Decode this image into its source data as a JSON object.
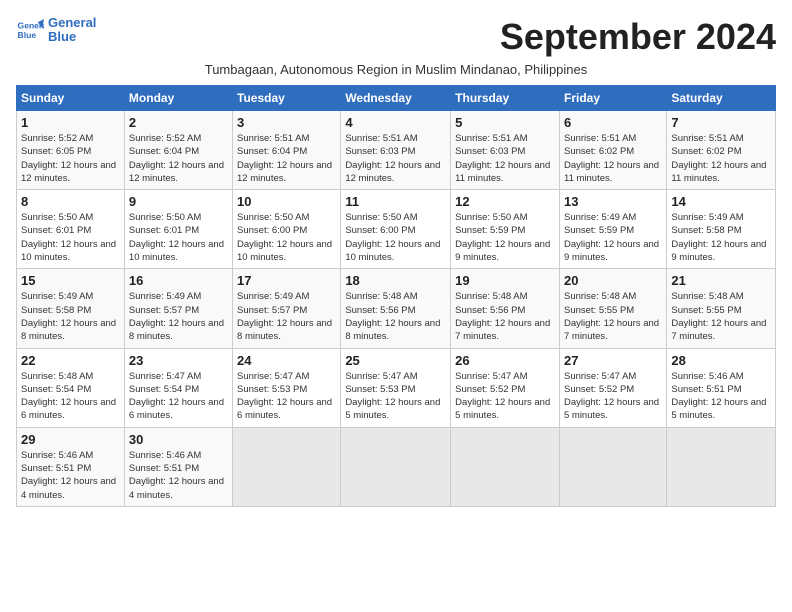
{
  "logo": {
    "line1": "General",
    "line2": "Blue"
  },
  "title": "September 2024",
  "subtitle": "Tumbagaan, Autonomous Region in Muslim Mindanao, Philippines",
  "days_header": [
    "Sunday",
    "Monday",
    "Tuesday",
    "Wednesday",
    "Thursday",
    "Friday",
    "Saturday"
  ],
  "weeks": [
    [
      {
        "day": "1",
        "sunrise": "5:52 AM",
        "sunset": "6:05 PM",
        "daylight": "12 hours and 12 minutes."
      },
      {
        "day": "2",
        "sunrise": "5:52 AM",
        "sunset": "6:04 PM",
        "daylight": "12 hours and 12 minutes."
      },
      {
        "day": "3",
        "sunrise": "5:51 AM",
        "sunset": "6:04 PM",
        "daylight": "12 hours and 12 minutes."
      },
      {
        "day": "4",
        "sunrise": "5:51 AM",
        "sunset": "6:03 PM",
        "daylight": "12 hours and 12 minutes."
      },
      {
        "day": "5",
        "sunrise": "5:51 AM",
        "sunset": "6:03 PM",
        "daylight": "12 hours and 11 minutes."
      },
      {
        "day": "6",
        "sunrise": "5:51 AM",
        "sunset": "6:02 PM",
        "daylight": "12 hours and 11 minutes."
      },
      {
        "day": "7",
        "sunrise": "5:51 AM",
        "sunset": "6:02 PM",
        "daylight": "12 hours and 11 minutes."
      }
    ],
    [
      {
        "day": "8",
        "sunrise": "5:50 AM",
        "sunset": "6:01 PM",
        "daylight": "12 hours and 10 minutes."
      },
      {
        "day": "9",
        "sunrise": "5:50 AM",
        "sunset": "6:01 PM",
        "daylight": "12 hours and 10 minutes."
      },
      {
        "day": "10",
        "sunrise": "5:50 AM",
        "sunset": "6:00 PM",
        "daylight": "12 hours and 10 minutes."
      },
      {
        "day": "11",
        "sunrise": "5:50 AM",
        "sunset": "6:00 PM",
        "daylight": "12 hours and 10 minutes."
      },
      {
        "day": "12",
        "sunrise": "5:50 AM",
        "sunset": "5:59 PM",
        "daylight": "12 hours and 9 minutes."
      },
      {
        "day": "13",
        "sunrise": "5:49 AM",
        "sunset": "5:59 PM",
        "daylight": "12 hours and 9 minutes."
      },
      {
        "day": "14",
        "sunrise": "5:49 AM",
        "sunset": "5:58 PM",
        "daylight": "12 hours and 9 minutes."
      }
    ],
    [
      {
        "day": "15",
        "sunrise": "5:49 AM",
        "sunset": "5:58 PM",
        "daylight": "12 hours and 8 minutes."
      },
      {
        "day": "16",
        "sunrise": "5:49 AM",
        "sunset": "5:57 PM",
        "daylight": "12 hours and 8 minutes."
      },
      {
        "day": "17",
        "sunrise": "5:49 AM",
        "sunset": "5:57 PM",
        "daylight": "12 hours and 8 minutes."
      },
      {
        "day": "18",
        "sunrise": "5:48 AM",
        "sunset": "5:56 PM",
        "daylight": "12 hours and 8 minutes."
      },
      {
        "day": "19",
        "sunrise": "5:48 AM",
        "sunset": "5:56 PM",
        "daylight": "12 hours and 7 minutes."
      },
      {
        "day": "20",
        "sunrise": "5:48 AM",
        "sunset": "5:55 PM",
        "daylight": "12 hours and 7 minutes."
      },
      {
        "day": "21",
        "sunrise": "5:48 AM",
        "sunset": "5:55 PM",
        "daylight": "12 hours and 7 minutes."
      }
    ],
    [
      {
        "day": "22",
        "sunrise": "5:48 AM",
        "sunset": "5:54 PM",
        "daylight": "12 hours and 6 minutes."
      },
      {
        "day": "23",
        "sunrise": "5:47 AM",
        "sunset": "5:54 PM",
        "daylight": "12 hours and 6 minutes."
      },
      {
        "day": "24",
        "sunrise": "5:47 AM",
        "sunset": "5:53 PM",
        "daylight": "12 hours and 6 minutes."
      },
      {
        "day": "25",
        "sunrise": "5:47 AM",
        "sunset": "5:53 PM",
        "daylight": "12 hours and 5 minutes."
      },
      {
        "day": "26",
        "sunrise": "5:47 AM",
        "sunset": "5:52 PM",
        "daylight": "12 hours and 5 minutes."
      },
      {
        "day": "27",
        "sunrise": "5:47 AM",
        "sunset": "5:52 PM",
        "daylight": "12 hours and 5 minutes."
      },
      {
        "day": "28",
        "sunrise": "5:46 AM",
        "sunset": "5:51 PM",
        "daylight": "12 hours and 5 minutes."
      }
    ],
    [
      {
        "day": "29",
        "sunrise": "5:46 AM",
        "sunset": "5:51 PM",
        "daylight": "12 hours and 4 minutes."
      },
      {
        "day": "30",
        "sunrise": "5:46 AM",
        "sunset": "5:51 PM",
        "daylight": "12 hours and 4 minutes."
      },
      null,
      null,
      null,
      null,
      null
    ]
  ]
}
